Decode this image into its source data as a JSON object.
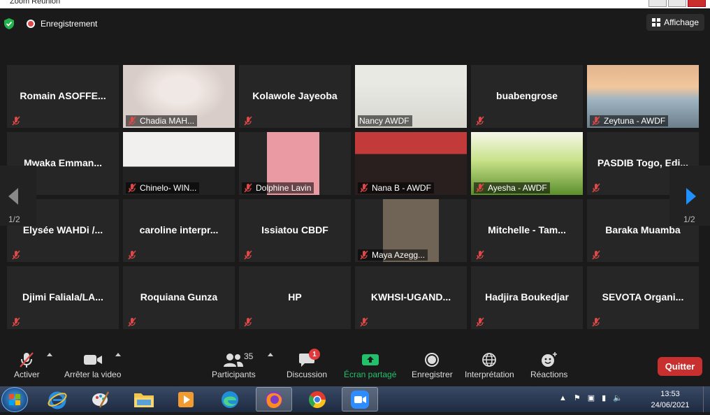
{
  "window": {
    "title": "Zoom Réunion"
  },
  "topbar": {
    "recording_label": "Enregistrement",
    "view_label": "Affichage"
  },
  "pagination": {
    "left": "1/2",
    "right": "1/2"
  },
  "participants": [
    {
      "name": "Romain  ASOFFE...",
      "video": false
    },
    {
      "name": "Chadia MAH...",
      "video": true
    },
    {
      "name": "Kolawole Jayeoba",
      "video": false
    },
    {
      "name": "Nancy AWDF",
      "video": true,
      "active_speaker": true
    },
    {
      "name": "buabengrose",
      "video": false
    },
    {
      "name": "Zeytuna - AWDF",
      "video": true
    },
    {
      "name": "Mwaka  Emman...",
      "video": false
    },
    {
      "name": "Chinelo- WIN...",
      "video": true
    },
    {
      "name": "Dolphine Lavin",
      "video": true
    },
    {
      "name": "Nana B - AWDF",
      "video": true
    },
    {
      "name": "Ayesha - AWDF",
      "video": true
    },
    {
      "name": "PASDIB Togo,  Edi...",
      "video": false
    },
    {
      "name": "Elysée WAHDi /...",
      "video": false
    },
    {
      "name": "caroline  interpr...",
      "video": false
    },
    {
      "name": "Issiatou  CBDF",
      "video": false
    },
    {
      "name": "Maya Azegg...",
      "video": true
    },
    {
      "name": "Mitchelle - Tam...",
      "video": false
    },
    {
      "name": "Baraka Muamba",
      "video": false
    },
    {
      "name": "Djimi  Faliala/LA...",
      "video": false
    },
    {
      "name": "Roquiana Gunza",
      "video": false
    },
    {
      "name": "HP",
      "video": false
    },
    {
      "name": "KWHSI-UGAND...",
      "video": false
    },
    {
      "name": "Hadjira Boukedjar",
      "video": false
    },
    {
      "name": "SEVOTA  Organi...",
      "video": false
    }
  ],
  "toolbar": {
    "mute": "Activer",
    "video": "Arrêter la video",
    "participants": "Participants",
    "participant_count": "35",
    "chat": "Discussion",
    "chat_badge": "1",
    "share": "Écran partagé",
    "record": "Enregistrer",
    "interpretation": "Interprétation",
    "reactions": "Réactions",
    "leave": "Quitter"
  },
  "taskbar": {
    "time": "13:53",
    "date": "24/06/2021"
  },
  "colors": {
    "active_speaker": "#b5e15a",
    "share_green": "#22c06b",
    "leave_red": "#c7302e",
    "nav_blue": "#1e90ff"
  }
}
